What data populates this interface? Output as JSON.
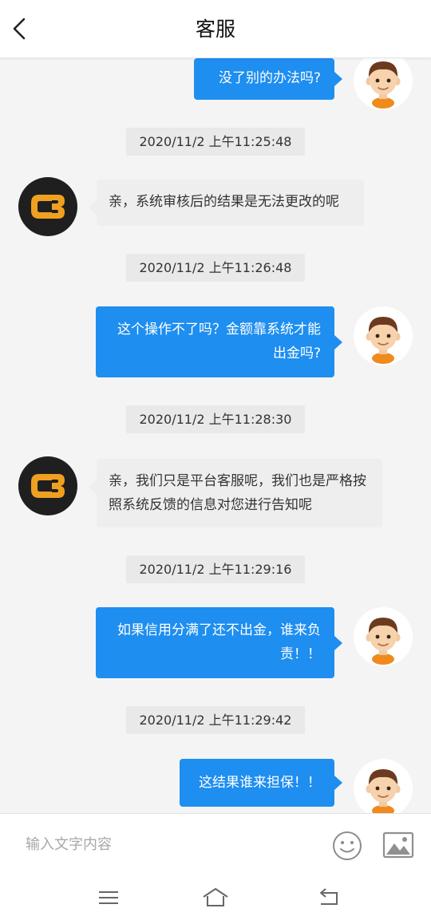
{
  "header": {
    "title": "客服"
  },
  "messages": [
    {
      "type": "out",
      "text": "没了别的办法吗?"
    },
    {
      "type": "time",
      "text": "2020/11/2 上午11:25:48"
    },
    {
      "type": "in",
      "text": "亲，系统审核后的结果是无法更改的呢"
    },
    {
      "type": "time",
      "text": "2020/11/2 上午11:26:48"
    },
    {
      "type": "out",
      "text": "这个操作不了吗？金额靠系统才能出金吗?"
    },
    {
      "type": "time",
      "text": "2020/11/2 上午11:28:30"
    },
    {
      "type": "in",
      "text": "亲，我们只是平台客服呢，我们也是严格按照系统反馈的信息对您进行告知呢"
    },
    {
      "type": "time",
      "text": "2020/11/2 上午11:29:16"
    },
    {
      "type": "out",
      "text": "如果信用分满了还不出金，谁来负责！！"
    },
    {
      "type": "time",
      "text": "2020/11/2 上午11:29:42"
    },
    {
      "type": "out",
      "text": "这结果谁来担保！！"
    }
  ],
  "input": {
    "placeholder": "输入文字内容"
  },
  "icons": {
    "back": "back-arrow-icon",
    "emoji": "smiley-icon",
    "image": "image-icon",
    "menu": "menu-icon",
    "home": "home-icon",
    "return": "return-icon"
  },
  "colors": {
    "outgoing_bubble": "#1e8ef0",
    "incoming_bubble": "#eeeeee",
    "timestamp_bg": "#e9e9e9",
    "bot_logo": "#f0a020"
  }
}
